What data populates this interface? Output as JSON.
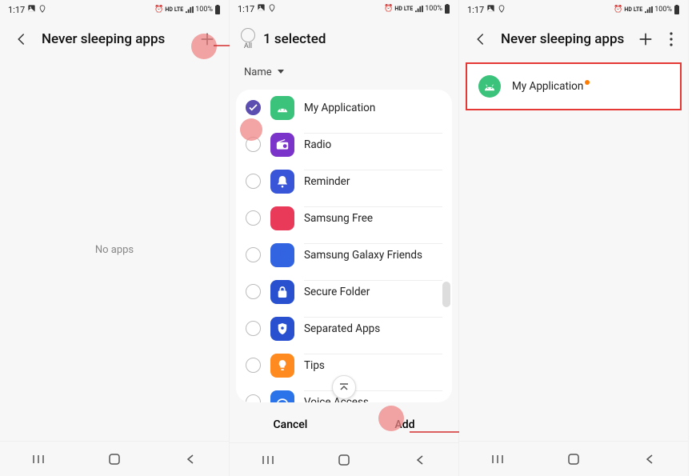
{
  "status": {
    "time": "1:17",
    "hd": "HD",
    "lte": "LTE",
    "battery_pct": "100%"
  },
  "screen1": {
    "title": "Never sleeping apps",
    "empty_text": "No apps"
  },
  "screen2": {
    "all_label": "All",
    "selected_text": "1 selected",
    "sort_label": "Name",
    "apps": [
      {
        "name": "My Application",
        "checked": true,
        "bg": "#3bc37b",
        "kind": "android"
      },
      {
        "name": "Radio",
        "checked": false,
        "bg": "#7b34c9",
        "kind": "radio"
      },
      {
        "name": "Reminder",
        "checked": false,
        "bg": "#3956d8",
        "kind": "bell"
      },
      {
        "name": "Samsung Free",
        "checked": false,
        "bg": "#e93a5a",
        "kind": "free"
      },
      {
        "name": "Samsung Galaxy Friends",
        "checked": false,
        "bg": "#3263e0",
        "kind": "f"
      },
      {
        "name": "Secure Folder",
        "checked": false,
        "bg": "#2850cf",
        "kind": "lock"
      },
      {
        "name": "Separated Apps",
        "checked": false,
        "bg": "#2850cf",
        "kind": "shield"
      },
      {
        "name": "Tips",
        "checked": false,
        "bg": "#ff8a1f",
        "kind": "bulb"
      },
      {
        "name": "Voice Access",
        "checked": false,
        "bg": "#2b73e8",
        "kind": "voice"
      }
    ],
    "cancel": "Cancel",
    "add": "Add"
  },
  "screen3": {
    "title": "Never sleeping apps",
    "result_app": "My Application"
  }
}
